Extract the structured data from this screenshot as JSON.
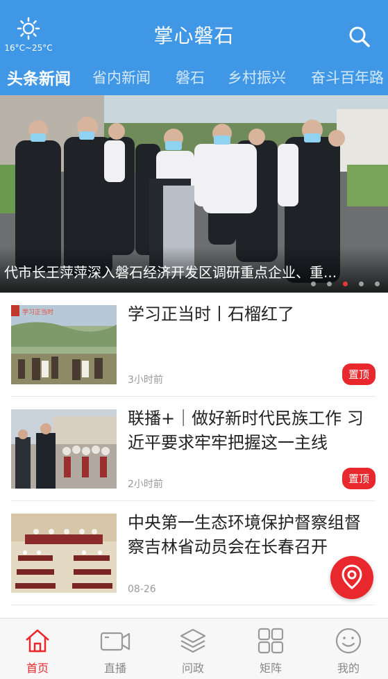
{
  "header": {
    "weather": "16°C~25°C",
    "title": "掌心磐石"
  },
  "tabs": [
    {
      "label": "头条新闻",
      "active": true
    },
    {
      "label": "省内新闻",
      "active": false
    },
    {
      "label": "磐石",
      "active": false
    },
    {
      "label": "乡村振兴",
      "active": false
    },
    {
      "label": "奋斗百年路",
      "active": false
    }
  ],
  "banner": {
    "caption": "代市长王萍萍深入磐石经济开发区调研重点企业、重...",
    "slide_count": 5,
    "active_slide": 3
  },
  "news": [
    {
      "title": "学习正当时丨石榴红了",
      "time": "3小时前",
      "badge": "置顶",
      "thumb_text": "学习正当时"
    },
    {
      "title": "联播+｜做好新时代民族工作 习近平要求牢牢把握这一主线",
      "time": "2小时前",
      "badge": "置顶"
    },
    {
      "title": "中央第一生态环境保护督察组督察吉林省动员会在长春召开",
      "time": "08-26"
    }
  ],
  "bottom_nav": [
    {
      "label": "首页",
      "icon": "home-icon",
      "active": true
    },
    {
      "label": "直播",
      "icon": "video-camera-icon",
      "active": false
    },
    {
      "label": "问政",
      "icon": "layers-icon",
      "active": false
    },
    {
      "label": "矩阵",
      "icon": "grid-icon",
      "active": false
    },
    {
      "label": "我的",
      "icon": "smiley-icon",
      "active": false
    }
  ],
  "colors": {
    "primary": "#3f97e6",
    "accent": "#e8282d"
  }
}
